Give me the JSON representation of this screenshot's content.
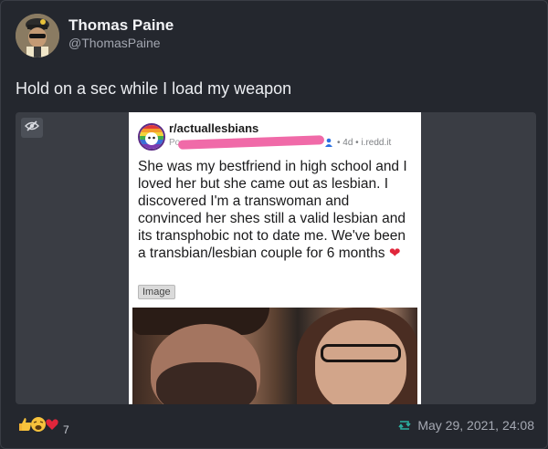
{
  "author": {
    "display_name": "Thomas Paine",
    "handle": "@ThomasPaine"
  },
  "post": {
    "text": "Hold on a sec while I load my weapon"
  },
  "embedded_screenshot": {
    "subreddit": "r/actuallesbians",
    "posted_prefix": "Po",
    "age_source": "• 4d • i.redd.it",
    "body": "She was my bestfriend in high school and I loved her but she came out as lesbian. I discovered I'm a transwoman and convinced her shes still a valid lesbian and its transphobic not to date me. We've been a transbian/lesbian couple for 6 months",
    "heart": "❤",
    "tag": "Image"
  },
  "footer": {
    "reaction_count": "7",
    "timestamp": "May 29, 2021, 24:08"
  },
  "icons": {
    "hide_media": "eye-slash-icon",
    "reactions": [
      "thumbs-up-icon",
      "tired-face-icon",
      "heart-icon"
    ],
    "repost": "repost-icon"
  },
  "colors": {
    "background": "#24272e",
    "media_bg": "#3a3d44",
    "redaction": "#f06aa8",
    "heart": "#e0263b",
    "repost": "#2bb0a0"
  }
}
